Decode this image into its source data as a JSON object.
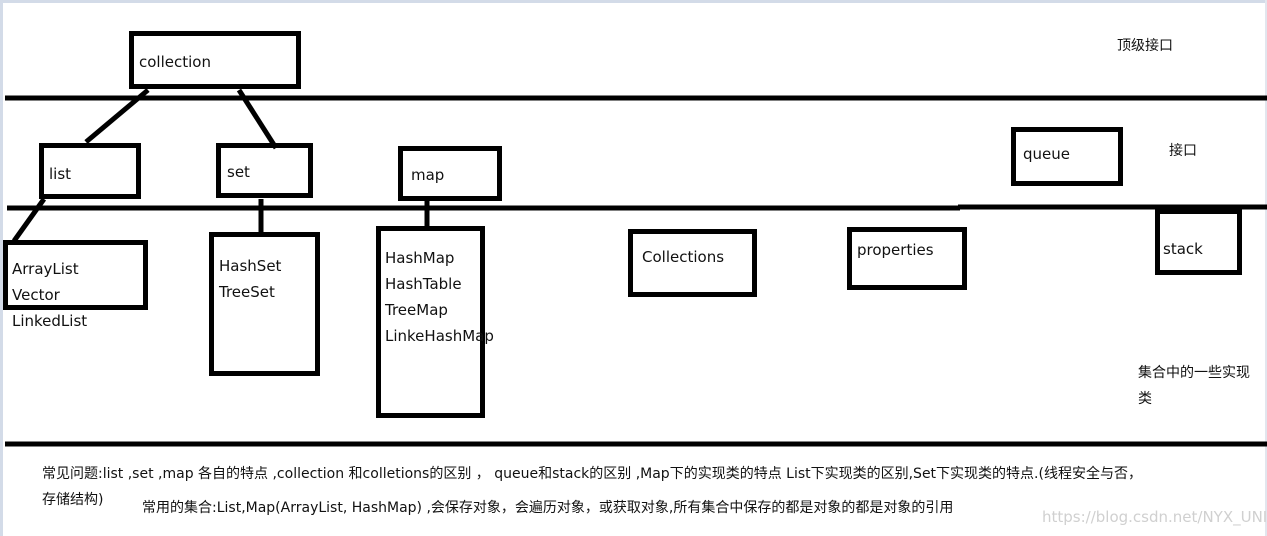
{
  "diagram": {
    "top_level": {
      "name": "collection",
      "tier_label": "顶级接口"
    },
    "interfaces": {
      "tier_label": "接口",
      "items": [
        "list",
        "set",
        "map",
        "queue"
      ]
    },
    "implementations": {
      "tier_label_line1": "集合中的一些实现",
      "tier_label_line2": "类",
      "list_impls": [
        "ArrayList",
        "Vector",
        "LinkedList"
      ],
      "set_impls": [
        "HashSet",
        "TreeSet"
      ],
      "map_impls": [
        "HashMap",
        "HashTable",
        "TreeMap",
        "LinkeHashMap"
      ],
      "collections": "Collections",
      "properties": "properties",
      "stack": "stack"
    },
    "notes": {
      "faq_line1": "常见问题:list ,set ,map 各自的特点  ,collection 和colletions的区别   ，  queue和stack的区别  ,Map下的实现类的特点  List下实现类的区别,Set下实现类的特点.(线程安全与否，",
      "faq_line2": "存储结构)",
      "common": "常用的集合:List,Map(ArrayList, HashMap)   ,会保存对象，会遍历对象，或获取对象,所有集合中保存的都是对象的都是对象的引用"
    },
    "watermark": "https://blog.csdn.net/NYX_UNI"
  }
}
